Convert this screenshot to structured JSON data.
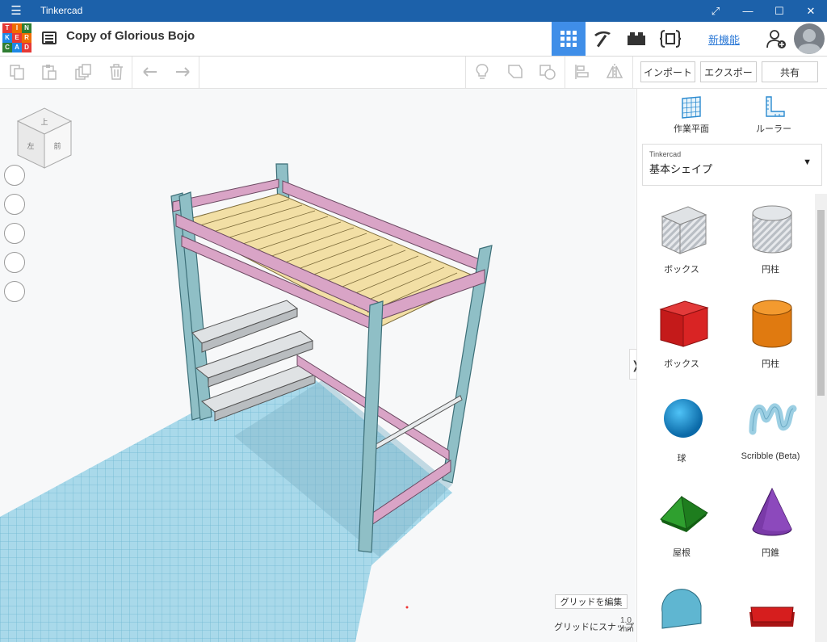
{
  "window": {
    "title": "Tinkercad",
    "menu_glyph": "☰",
    "expand_glyph": "⤢",
    "min_glyph": "—",
    "max_glyph": "☐",
    "close_glyph": "✕"
  },
  "header": {
    "logo_letters": [
      "T",
      "I",
      "N",
      "K",
      "E",
      "R",
      "C",
      "A",
      "D"
    ],
    "doc_title": "Copy of Glorious Bojo",
    "new_features": "新機能"
  },
  "toolbar": {
    "import": "インポート",
    "export": "エクスポート",
    "share": "共有"
  },
  "sidebar": {
    "workplane": "作業平面",
    "ruler": "ルーラー",
    "library_category": "Tinkercad",
    "library_name": "基本シェイプ",
    "shapes": [
      {
        "label": "ボックス",
        "icon": "box-striped"
      },
      {
        "label": "円柱",
        "icon": "cylinder-striped"
      },
      {
        "label": "ボックス",
        "icon": "box-red"
      },
      {
        "label": "円柱",
        "icon": "cylinder-orange"
      },
      {
        "label": "球",
        "icon": "sphere-blue"
      },
      {
        "label": "Scribble (Beta)",
        "icon": "scribble"
      },
      {
        "label": "屋根",
        "icon": "roof-green"
      },
      {
        "label": "円錐",
        "icon": "cone-purple"
      }
    ]
  },
  "viewport": {
    "viewcube_top": "上",
    "viewcube_front": "前",
    "viewcube_left": "左",
    "edit_grid": "グリッドを編集",
    "snap_label": "グリッドにスナップ",
    "snap_value": "1.0",
    "snap_unit": "mm"
  },
  "colors": {
    "titlebar": "#1c61aa",
    "accent": "#3f8ee8",
    "post": "#8fbfc6",
    "rail": "#d9a4c6",
    "slat": "#f2dfa5"
  }
}
